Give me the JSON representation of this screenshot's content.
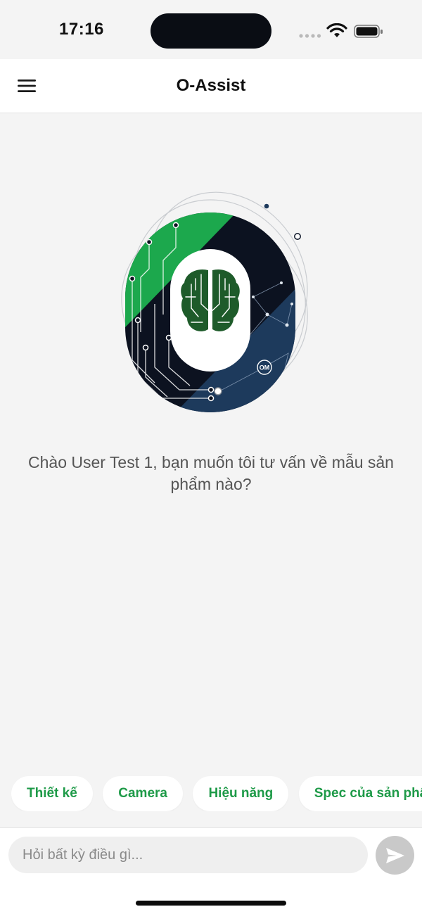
{
  "status_bar": {
    "time": "17:16"
  },
  "header": {
    "title": "O-Assist"
  },
  "main": {
    "greeting": "Chào User Test 1, bạn muốn tôi tư vấn về mẫu sản phẩm nào?",
    "logo": {
      "badge_text": "OM",
      "colors": {
        "green": "#1ca84d",
        "navy": "#0c1220",
        "blue": "#1d3a5c",
        "brain": "#1e5b2a"
      }
    }
  },
  "suggestions": [
    {
      "label": "Thiết kế"
    },
    {
      "label": "Camera"
    },
    {
      "label": "Hiệu năng"
    },
    {
      "label": "Spec của sản phẩm"
    }
  ],
  "composer": {
    "placeholder": "Hỏi bất kỳ điều gì...",
    "value": "",
    "send_icon": "send-icon"
  },
  "colors": {
    "accent": "#1e9a48",
    "background": "#f4f4f4",
    "send_disabled": "#c9c9c9"
  }
}
